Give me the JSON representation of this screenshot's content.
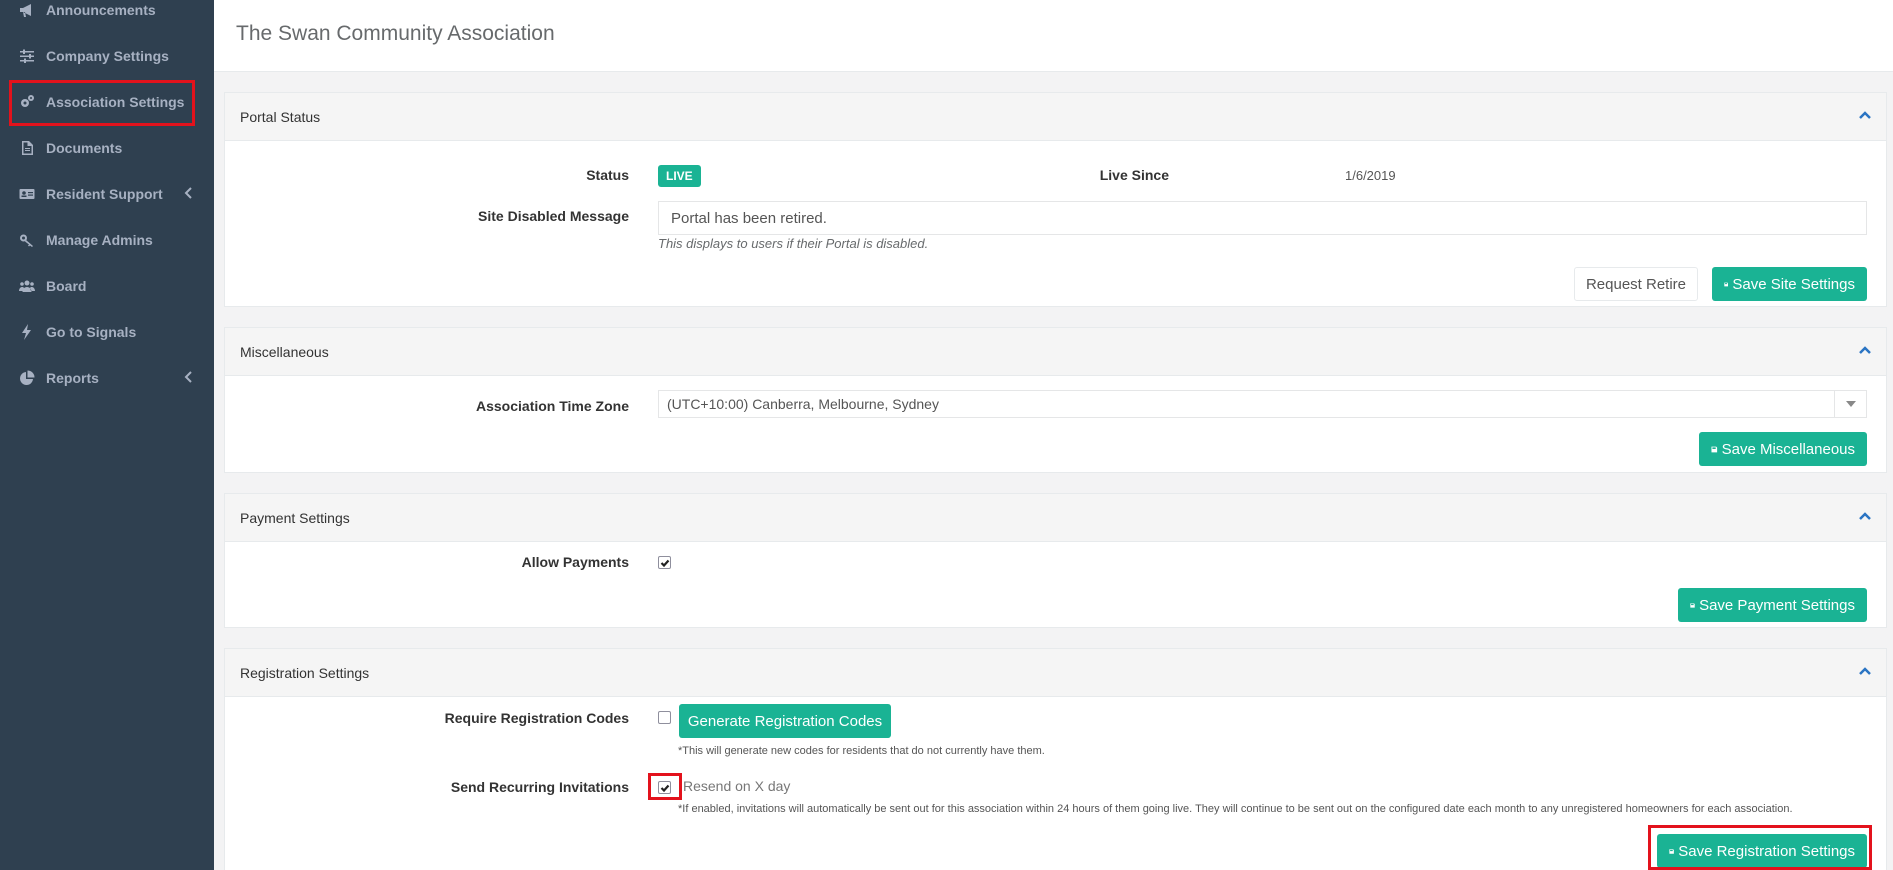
{
  "sidebar": {
    "items": [
      {
        "label": "Announcements",
        "icon": "megaphone-icon"
      },
      {
        "label": "Company Settings",
        "icon": "sliders-icon"
      },
      {
        "label": "Association Settings",
        "icon": "gears-icon"
      },
      {
        "label": "Documents",
        "icon": "document-icon"
      },
      {
        "label": "Resident Support",
        "icon": "id-card-icon"
      },
      {
        "label": "Manage Admins",
        "icon": "key-icon"
      },
      {
        "label": "Board",
        "icon": "users-icon"
      },
      {
        "label": "Go to Signals",
        "icon": "bolt-icon"
      },
      {
        "label": "Reports",
        "icon": "pie-chart-icon"
      }
    ]
  },
  "header": {
    "title": "The Swan Community Association"
  },
  "portal": {
    "title": "Portal Status",
    "status_label": "Status",
    "status_value": "LIVE",
    "live_since_label": "Live Since",
    "live_since_value": "1/6/2019",
    "disabled_msg_label": "Site Disabled Message",
    "disabled_msg_value": "Portal has been retired.",
    "disabled_msg_help": "This displays to users if their Portal is disabled.",
    "request_retire": "Request Retire",
    "save": "Save Site Settings"
  },
  "misc": {
    "title": "Miscellaneous",
    "tz_label": "Association Time Zone",
    "tz_value": "(UTC+10:00) Canberra, Melbourne, Sydney",
    "save": "Save Miscellaneous"
  },
  "payment": {
    "title": "Payment Settings",
    "allow_label": "Allow Payments",
    "allow_checked": true,
    "save": "Save Payment Settings"
  },
  "registration": {
    "title": "Registration Settings",
    "codes_label": "Require Registration Codes",
    "codes_checked": false,
    "generate": "Generate Registration Codes",
    "codes_note": "*This will generate new codes for residents that do not currently have them.",
    "recurring_label": "Send Recurring Invitations",
    "recurring_checked": true,
    "resend_text": "Resend on X day",
    "recurring_note": "*If enabled, invitations will automatically be sent out for this association within 24 hours of them going live. They will continue to be sent out on the configured date each month to any unregistered homeowners for each association.",
    "save": "Save Registration Settings"
  },
  "colors": {
    "sidebar_bg": "#2f4050",
    "accent": "#1ab394",
    "highlight": "#e3121c"
  }
}
